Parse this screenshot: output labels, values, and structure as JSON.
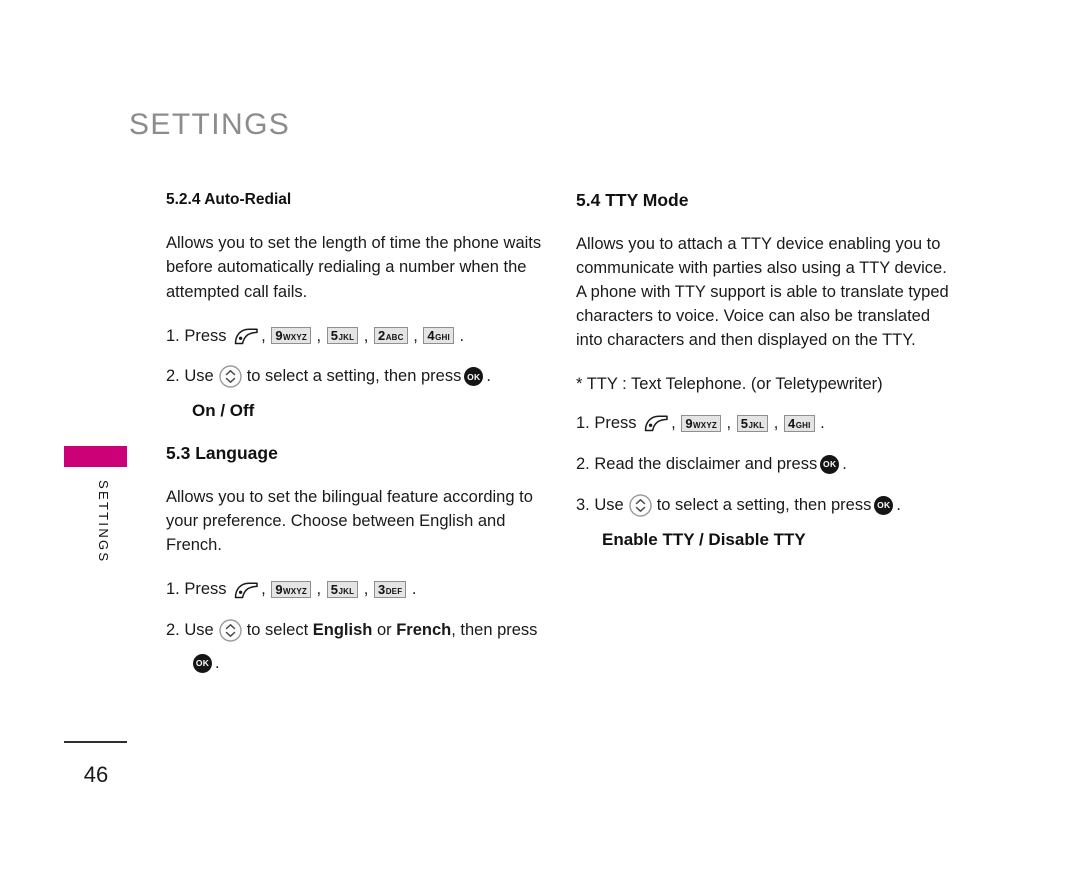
{
  "page": {
    "title": "SETTINGS",
    "side_tab_label": "SETTINGS",
    "page_number": "46",
    "accent_color": "#cc0077",
    "title_color": "#8c8c8c"
  },
  "icons": {
    "send": "send-key-icon",
    "nav": "navigation-up-down-icon",
    "ok": "OK"
  },
  "left_column": {
    "section_auto_redial": {
      "heading": "5.2.4 Auto-Redial",
      "body": "Allows you to set the length of time the phone waits before automatically redialing a number when the attempted call fails.",
      "step1": {
        "number": "1.",
        "verb": "Press",
        "keys": [
          {
            "digit": "9",
            "letters": "WXYZ"
          },
          {
            "digit": "5",
            "letters": "JKL"
          },
          {
            "digit": "2",
            "letters": "ABC"
          },
          {
            "digit": "4",
            "letters": "GHI"
          }
        ],
        "period": "."
      },
      "step2": {
        "number": "2.",
        "verb": "Use",
        "mid": "to select a setting, then press",
        "period": "."
      },
      "options": "On / Off"
    },
    "section_language": {
      "heading": "5.3 Language",
      "body": "Allows you to set the bilingual feature according to your preference. Choose between English and French.",
      "step1": {
        "number": "1.",
        "verb": "Press",
        "keys": [
          {
            "digit": "9",
            "letters": "WXYZ"
          },
          {
            "digit": "5",
            "letters": "JKL"
          },
          {
            "digit": "3",
            "letters": "DEF"
          }
        ],
        "period": "."
      },
      "step2": {
        "number": "2.",
        "verb": "Use",
        "mid_a": "to select",
        "option_a": "English",
        "conj": "or",
        "option_b": "French",
        "mid_b": ", then press",
        "period": "."
      }
    }
  },
  "right_column": {
    "section_tty": {
      "heading": "5.4 TTY Mode",
      "body": "Allows you to attach a TTY device enabling you to communicate with parties also using a TTY device. A phone with TTY support is able to translate typed characters to voice. Voice can also be translated into characters and then displayed on the TTY.",
      "note": "* TTY :  Text Telephone. (or Teletypewriter)",
      "step1": {
        "number": "1.",
        "verb": "Press",
        "keys": [
          {
            "digit": "9",
            "letters": "WXYZ"
          },
          {
            "digit": "5",
            "letters": "JKL"
          },
          {
            "digit": "4",
            "letters": "GHI"
          }
        ],
        "period": "."
      },
      "step2": {
        "number": "2.",
        "text": "Read the disclaimer and press",
        "period": "."
      },
      "step3": {
        "number": "3.",
        "verb": "Use",
        "mid": "to select a setting, then press",
        "period": "."
      },
      "options": "Enable TTY / Disable TTY"
    }
  }
}
